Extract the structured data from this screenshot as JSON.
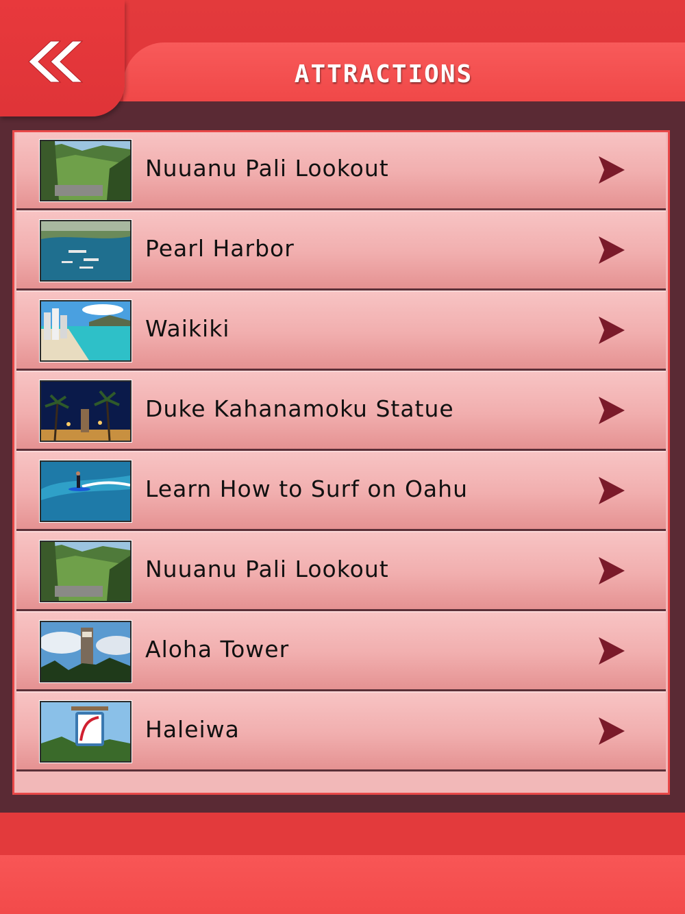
{
  "header": {
    "title": "ATTRACTIONS",
    "back_icon": "double-chevron-left-icon",
    "colors": {
      "header_red": "#e33a3c",
      "title_bar": "#f85a5a",
      "frame_border": "#e84848",
      "backdrop": "#5a2a34",
      "arrow": "#7a1a2a"
    }
  },
  "list": {
    "items": [
      {
        "label": "",
        "thumb": "coastline"
      },
      {
        "label": "Nuuanu Pali Lookout",
        "thumb": "cliff-valley"
      },
      {
        "label": "Pearl Harbor",
        "thumb": "harbor"
      },
      {
        "label": "Waikiki",
        "thumb": "beach"
      },
      {
        "label": "Duke Kahanamoku Statue",
        "thumb": "palms-night"
      },
      {
        "label": "Learn How to Surf on Oahu",
        "thumb": "surf"
      },
      {
        "label": "Nuuanu Pali Lookout",
        "thumb": "cliff-valley"
      },
      {
        "label": "Aloha Tower",
        "thumb": "tower"
      },
      {
        "label": "Haleiwa",
        "thumb": "haleiwa-sign"
      }
    ],
    "arrow_icon": "chevron-right-icon"
  }
}
